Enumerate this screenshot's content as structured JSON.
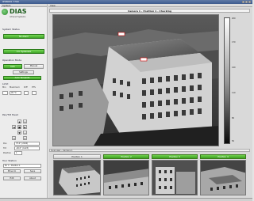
{
  "window": {
    "title": "IPS8000 7700"
  },
  "menu": {
    "left": "System",
    "right": "View"
  },
  "logo": {
    "name": "DIAS",
    "subtitle": "Infrared Systems"
  },
  "system_status": {
    "header": "System Status",
    "btn_ok": "No Alarm",
    "btn_hysteresis": "0 K Hysteresis"
  },
  "operation_mode": {
    "header": "Operation Mode",
    "auto_label": "Auto",
    "manual_label": "Manual",
    "settings_label": "Settings",
    "template_label": "Auto Template"
  },
  "limit": {
    "header": "Limit",
    "col_min": "Min",
    "col_max": "Maximum",
    "col_diff": "Diff",
    "col_pts": "PTS",
    "value": "45 °C"
  },
  "pan_tilt": {
    "header": "Pan/Tilt Head",
    "pan_label": "Pan",
    "tilt_label": "Tilt",
    "pos_label": "Position",
    "pan_value": "75.0° (2240)",
    "tilt_value": "-26.0° (1423)",
    "pos_value": "1"
  },
  "tour": {
    "header": "Tour Station",
    "station_value": "Nr. 1 - Position 1",
    "move_btn": "Move to",
    "save_btn": "Save",
    "edit_btn": "Edit",
    "about_btn": "About"
  },
  "video": {
    "title": "Camera 1 - Position 1 - Checking"
  },
  "overview": {
    "header": "Overview - Camera 1",
    "tabs": [
      "Position 1",
      "Position 2",
      "Position 3",
      "Position 4"
    ]
  },
  "scale": {
    "ticks": [
      "200",
      "170",
      "140",
      "110",
      "80",
      "50"
    ]
  }
}
